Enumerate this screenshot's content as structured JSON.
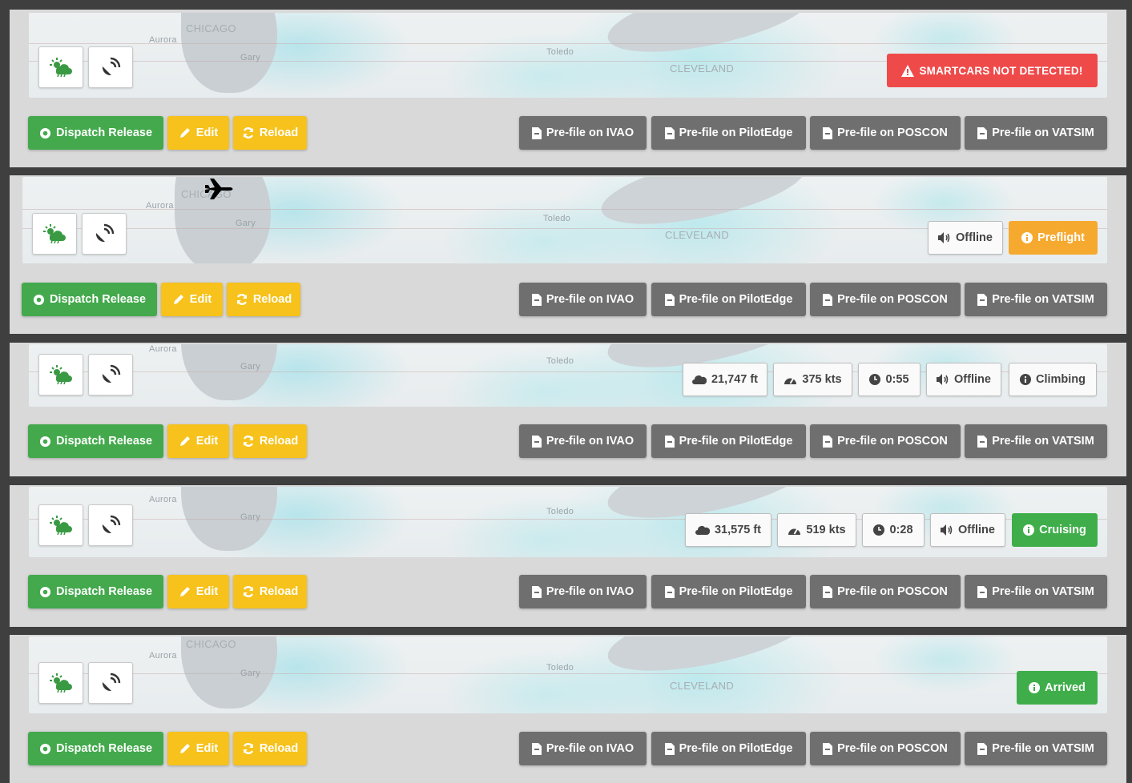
{
  "map_labels": {
    "chicago": "CHICAGO",
    "aurora": "Aurora",
    "gary": "Gary",
    "toledo": "Toledo",
    "cleveland": "CLEVELAND"
  },
  "actions": {
    "dispatch": "Dispatch Release",
    "edit": "Edit",
    "reload": "Reload",
    "ivao": "Pre-file on IVAO",
    "pilotedge": "Pre-file on PilotEdge",
    "poscon": "Pre-file on POSCON",
    "vatsim": "Pre-file on VATSIM"
  },
  "flights": [
    {
      "alert": "SMARTCARS NOT DETECTED!"
    },
    {
      "network": "Offline",
      "phase": "Preflight"
    },
    {
      "altitude": "21,747 ft",
      "speed": "375 kts",
      "time": "0:55",
      "network": "Offline",
      "phase": "Climbing"
    },
    {
      "altitude": "31,575 ft",
      "speed": "519 kts",
      "time": "0:28",
      "network": "Offline",
      "phase": "Cruising"
    },
    {
      "phase": "Arrived"
    }
  ],
  "colors": {
    "green": "#43a94c",
    "yellow": "#f6c21b",
    "gray": "#6f6f6f",
    "red": "#ef4a4a",
    "orange": "#f6a92f",
    "card": "#d9d9d9"
  }
}
